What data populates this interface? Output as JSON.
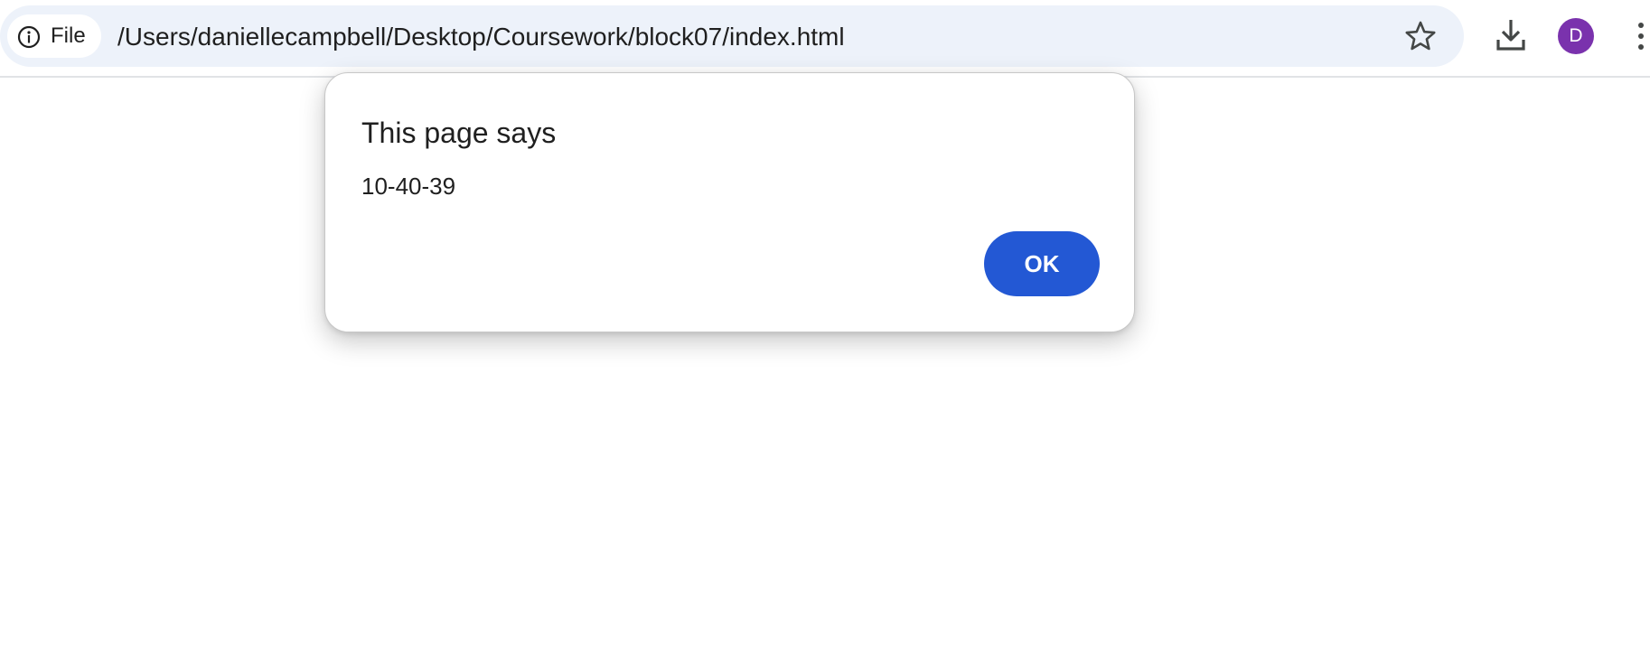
{
  "browser": {
    "site_chip_label": "File",
    "url": "/Users/daniellecampbell/Desktop/Coursework/block07/index.html",
    "profile_initial": "D",
    "profile_color": "#7a32ad"
  },
  "dialog": {
    "title": "This page says",
    "message": "10-40-39",
    "ok_label": "OK",
    "ok_color": "#2358d4"
  },
  "icons": {
    "site_info": "info-icon",
    "bookmark": "star-icon",
    "downloads": "download-icon",
    "menu": "more-vertical-icon"
  }
}
